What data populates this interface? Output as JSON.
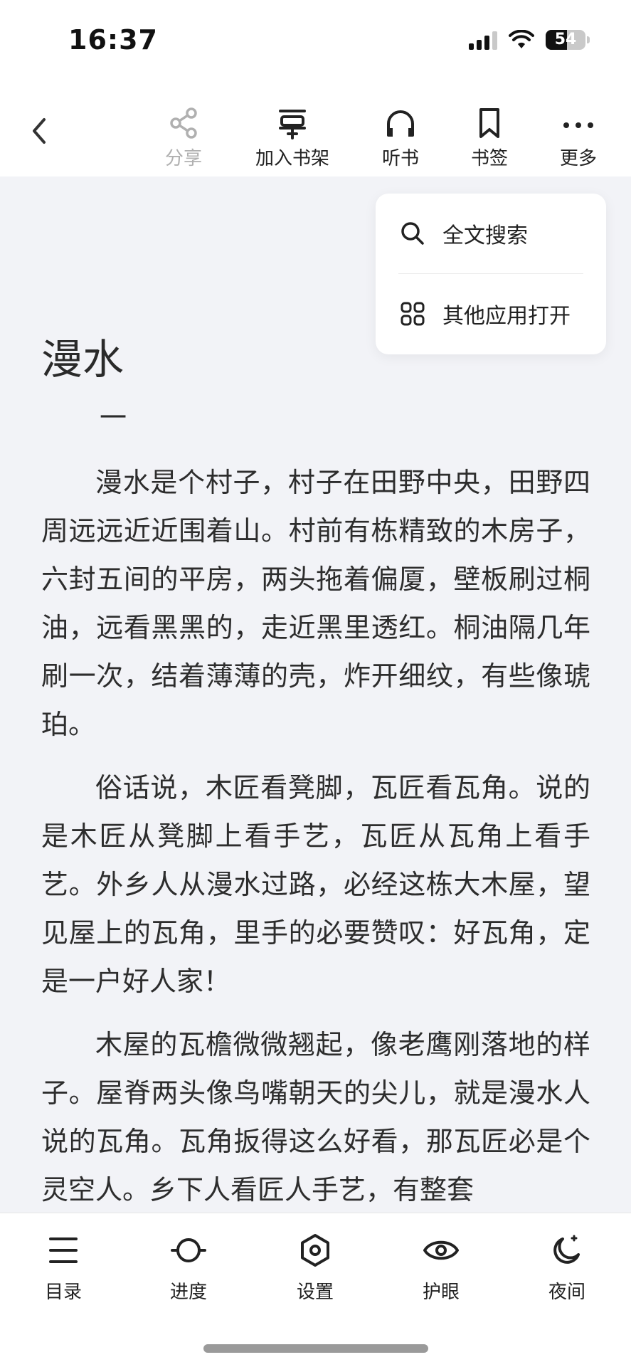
{
  "status_bar": {
    "time": "16:37",
    "battery": "54",
    "battery_level": 0.54
  },
  "toolbar": {
    "back_icon": "chevron-left-icon",
    "items": [
      {
        "label": "分享",
        "icon": "share-icon",
        "enabled": false
      },
      {
        "label": "加入书架",
        "icon": "bookshelf-add-icon",
        "enabled": true
      },
      {
        "label": "听书",
        "icon": "headphones-icon",
        "enabled": true
      },
      {
        "label": "书签",
        "icon": "bookmark-icon",
        "enabled": true
      },
      {
        "label": "更多",
        "icon": "more-dots-icon",
        "enabled": true
      }
    ]
  },
  "more_menu": {
    "items": [
      {
        "label": "全文搜索",
        "icon": "search-icon"
      },
      {
        "label": "其他应用打开",
        "icon": "apps-grid-icon"
      }
    ]
  },
  "reader": {
    "chapter_title": "漫水",
    "section_mark": "一",
    "paragraphs": [
      "漫水是个村子，村子在田野中央，田野四周远远近近围着山。村前有栋精致的木房子，六封五间的平房，两头拖着偏厦，壁板刷过桐油，远看黑黑的，走近黑里透红。桐油隔几年刷一次，结着薄薄的壳，炸开细纹，有些像琥珀。",
      "俗话说，木匠看凳脚，瓦匠看瓦角。说的是木匠从凳脚上看手艺，瓦匠从瓦角上看手艺。外乡人从漫水过路，必经这栋大木屋，望见屋上的瓦角，里手的必要赞叹：好瓦角，定是一户好人家！",
      "木屋的瓦檐微微翘起，像老鹰刚落地的样子。屋脊两头像鸟嘴朝天的尖儿，就是漫水人说的瓦角。瓦角扳得这么好看，那瓦匠必是个灵空人。乡下人看匠人手艺，有整套"
    ]
  },
  "bottom_nav": {
    "items": [
      {
        "label": "目录",
        "icon": "menu-lines-icon"
      },
      {
        "label": "进度",
        "icon": "progress-icon"
      },
      {
        "label": "设置",
        "icon": "settings-hexagon-icon"
      },
      {
        "label": "护眼",
        "icon": "eye-icon"
      },
      {
        "label": "夜间",
        "icon": "night-moon-icon"
      }
    ]
  },
  "colors": {
    "page_background": "#f2f3f7",
    "bar_background": "#ffffff",
    "text": "#2a2a2a",
    "disabled": "#b0b0b0"
  }
}
